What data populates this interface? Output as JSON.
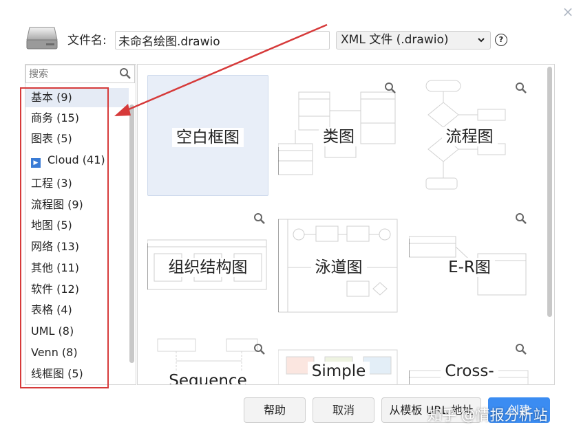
{
  "dialog": {
    "filename_label": "文件名:",
    "filename_value": "未命名绘图.drawio",
    "format_selected": "XML 文件 (.drawio)",
    "help_icon": "?",
    "close_icon": "×"
  },
  "sidebar": {
    "search_placeholder": "搜索",
    "categories": [
      {
        "label": "基本 (9)"
      },
      {
        "label": "商务 (15)"
      },
      {
        "label": "图表 (5)"
      },
      {
        "label": "Cloud (41)"
      },
      {
        "label": "工程 (3)"
      },
      {
        "label": "流程图 (9)"
      },
      {
        "label": "地图 (5)"
      },
      {
        "label": "网络 (13)"
      },
      {
        "label": "其他 (11)"
      },
      {
        "label": "软件 (12)"
      },
      {
        "label": "表格 (4)"
      },
      {
        "label": "UML (8)"
      },
      {
        "label": "Venn (8)"
      },
      {
        "label": "线框图 (5)"
      }
    ]
  },
  "templates": [
    {
      "label": "空白框图"
    },
    {
      "label": "类图"
    },
    {
      "label": "流程图"
    },
    {
      "label": "组织结构图"
    },
    {
      "label": "泳道图"
    },
    {
      "label": "E-R图"
    },
    {
      "label": "Sequence"
    },
    {
      "label": "Simple"
    },
    {
      "label": "Cross-"
    }
  ],
  "buttons": {
    "help": "帮助",
    "cancel": "取消",
    "from_url": "从模板 URL 地址",
    "create": "创建"
  },
  "watermark": "知乎 @情报分析站",
  "colors": {
    "accent": "#3b8cf2",
    "selection": "#e5ebf5",
    "annotation_red": "#d63a3a"
  }
}
